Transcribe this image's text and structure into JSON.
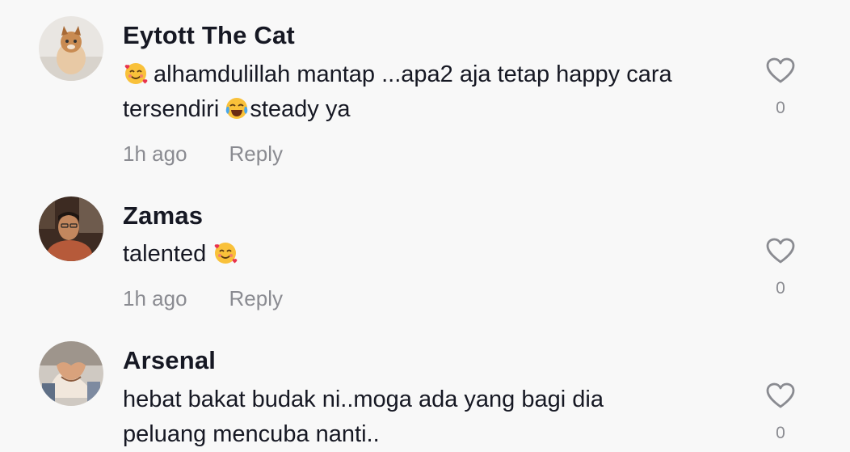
{
  "comments": [
    {
      "username": "Eytott The Cat",
      "emoji": "smiling-face-with-hearts",
      "text_before": "alhamdulillah mantap ...apa2 aja tetap happy cara",
      "text_line2_a": "tersendiri",
      "emoji2": "face-with-tears-of-joy",
      "text_line2_b": "steady ya",
      "time": "1h ago",
      "reply_label": "Reply",
      "likes": "0"
    },
    {
      "username": "Zamas",
      "text": "talented",
      "emoji": "smiling-face-with-hearts",
      "time": "1h ago",
      "reply_label": "Reply",
      "likes": "0"
    },
    {
      "username": "Arsenal",
      "text_line1": "hebat bakat budak ni..moga ada yang bagi dia",
      "text_line2": "peluang mencuba nanti..",
      "likes": "0"
    }
  ],
  "colors": {
    "background": "#f8f8f8",
    "text": "#161823",
    "muted": "#8a8b91"
  }
}
